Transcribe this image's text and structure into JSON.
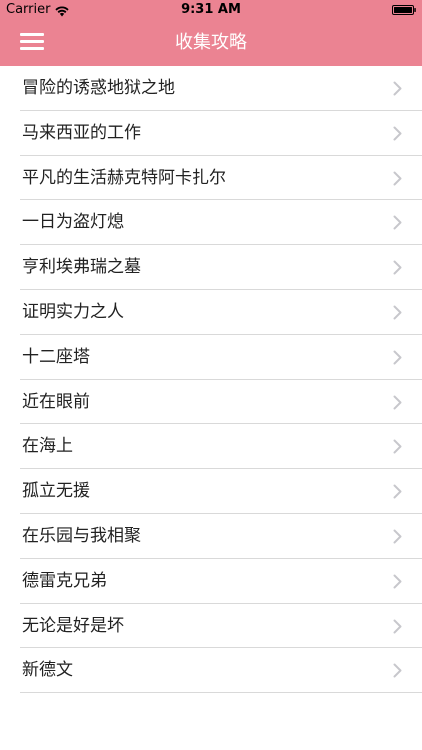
{
  "status_bar": {
    "carrier": "Carrier",
    "time": "9:31 AM"
  },
  "nav": {
    "title": "收集攻略",
    "menu_icon": "hamburger-menu-icon",
    "background_color": "#eb8392"
  },
  "list": {
    "items": [
      {
        "label": "冒险的诱惑地狱之地"
      },
      {
        "label": "马来西亚的工作"
      },
      {
        "label": "平凡的生活赫克特阿卡扎尔"
      },
      {
        "label": "一日为盗灯熄"
      },
      {
        "label": "亨利埃弗瑞之墓"
      },
      {
        "label": "证明实力之人"
      },
      {
        "label": "十二座塔"
      },
      {
        "label": "近在眼前"
      },
      {
        "label": "在海上"
      },
      {
        "label": "孤立无援"
      },
      {
        "label": "在乐园与我相聚"
      },
      {
        "label": "德雷克兄弟"
      },
      {
        "label": "无论是好是坏"
      },
      {
        "label": "新德文"
      }
    ],
    "row_icon": "chevron-right-icon"
  }
}
